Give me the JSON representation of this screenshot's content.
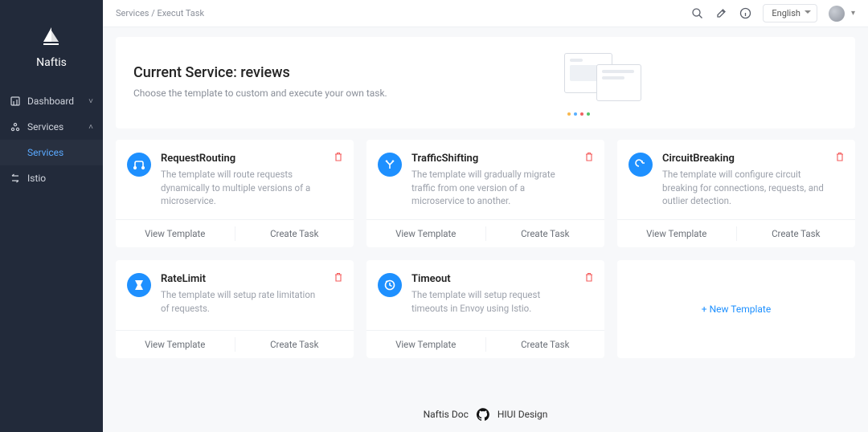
{
  "brand": {
    "name": "Naftis"
  },
  "sidebar": {
    "items": [
      {
        "label": "Dashboard",
        "expandable": true,
        "expanded": false
      },
      {
        "label": "Services",
        "expandable": true,
        "expanded": true,
        "sub": [
          {
            "label": "Services"
          }
        ]
      },
      {
        "label": "Istio",
        "expandable": false
      }
    ]
  },
  "topbar": {
    "breadcrumb": "Services / Execut Task",
    "language": "English"
  },
  "hero": {
    "title": "Current Service: reviews",
    "subtitle": "Choose the template to custom and execute your own task."
  },
  "actions": {
    "view": "View Template",
    "create": "Create Task"
  },
  "new_template_label": "+ New Template",
  "cards": [
    {
      "icon": "route-icon",
      "title": "RequestRouting",
      "desc": "The template will route requests dynamically to multiple versions of a microservice."
    },
    {
      "icon": "shift-icon",
      "title": "TrafficShifting",
      "desc": "The template will gradually migrate traffic from one version of a microservice to another."
    },
    {
      "icon": "breaker-icon",
      "title": "CircuitBreaking",
      "desc": "The template will configure circuit breaking for connections, requests, and outlier detection."
    },
    {
      "icon": "ratelimit-icon",
      "title": "RateLimit",
      "desc": "The template will setup rate limitation of requests."
    },
    {
      "icon": "timeout-icon",
      "title": "Timeout",
      "desc": "The template will setup request timeouts in Envoy using Istio."
    }
  ],
  "footer": {
    "left": "Naftis Doc",
    "right": "HIUI Design"
  },
  "colors": {
    "accent": "#1e90ff",
    "danger": "#f45b5b"
  }
}
